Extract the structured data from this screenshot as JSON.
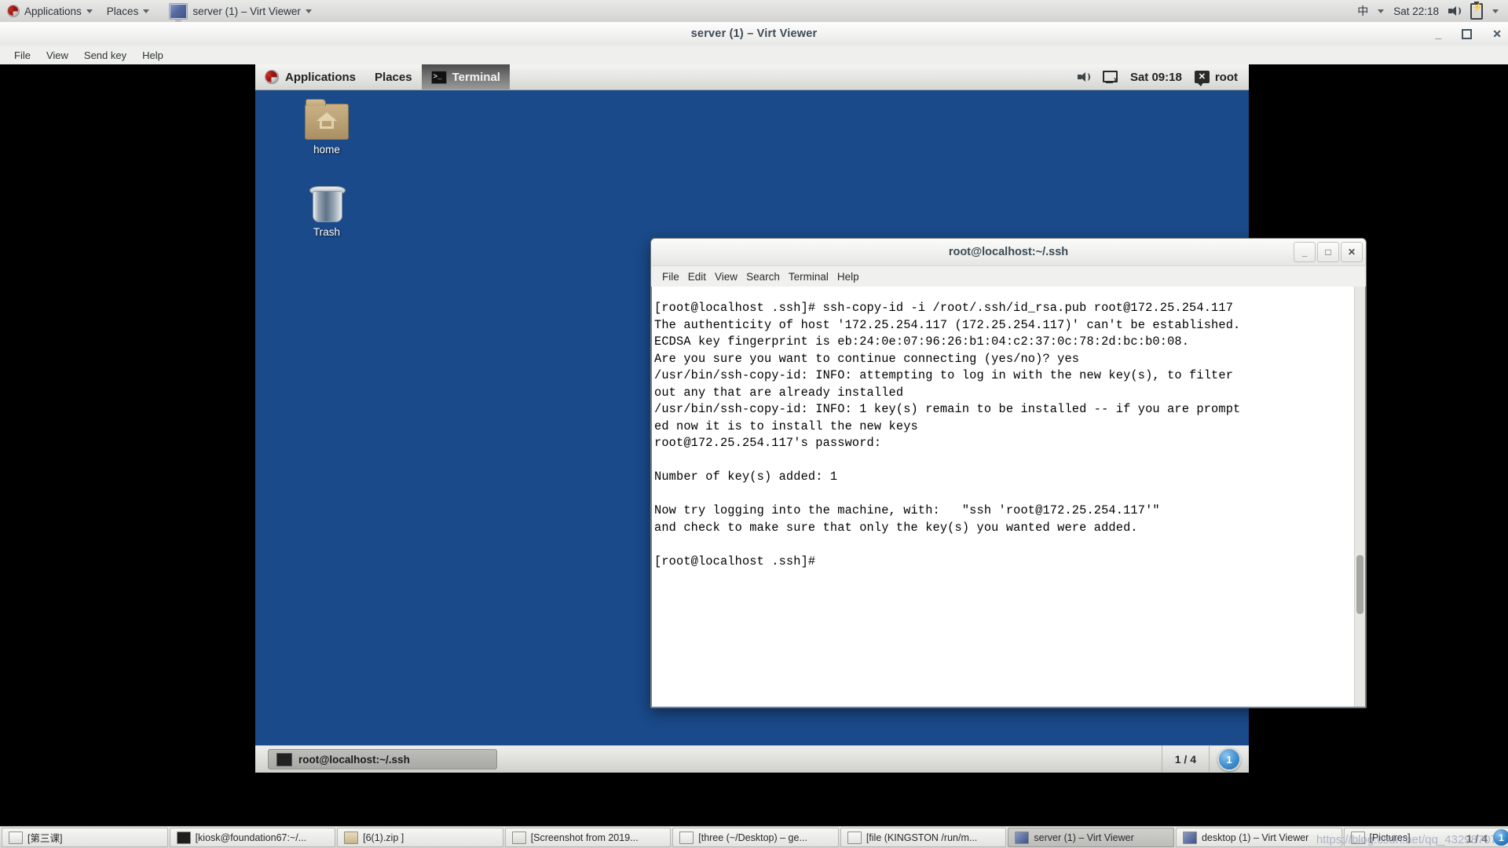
{
  "host_panel": {
    "applications": "Applications",
    "places": "Places",
    "window_task": "server (1) – Virt Viewer",
    "ime": "中",
    "clock": "Sat 22:18",
    "icons": {
      "fedora": "fedora-logo",
      "speaker": "volume-icon",
      "battery": "battery-icon"
    }
  },
  "virt_viewer": {
    "title": "server (1) – Virt Viewer",
    "menu": [
      "File",
      "View",
      "Send key",
      "Help"
    ],
    "window_buttons": {
      "minimize": "_",
      "maximize": "□",
      "close": "✕"
    }
  },
  "guest_panel": {
    "applications": "Applications",
    "places": "Places",
    "active_task": "Terminal",
    "clock": "Sat 09:18",
    "user": "root"
  },
  "desktop_icons": [
    {
      "label": "home",
      "icon": "home-folder-icon"
    },
    {
      "label": "Trash",
      "icon": "trash-icon"
    }
  ],
  "terminal": {
    "title": "root@localhost:~/.ssh",
    "menu": [
      "File",
      "Edit",
      "View",
      "Search",
      "Terminal",
      "Help"
    ],
    "window_buttons": {
      "minimize": "_",
      "maximize": "□",
      "close": "✕"
    },
    "content": "[root@localhost .ssh]# ssh-copy-id -i /root/.ssh/id_rsa.pub root@172.25.254.117\nThe authenticity of host '172.25.254.117 (172.25.254.117)' can't be established.\nECDSA key fingerprint is eb:24:0e:07:96:26:b1:04:c2:37:0c:78:2d:bc:b0:08.\nAre you sure you want to continue connecting (yes/no)? yes\n/usr/bin/ssh-copy-id: INFO: attempting to log in with the new key(s), to filter\nout any that are already installed\n/usr/bin/ssh-copy-id: INFO: 1 key(s) remain to be installed -- if you are prompt\ned now it is to install the new keys\nroot@172.25.254.117's password:\n\nNumber of key(s) added: 1\n\nNow try logging into the machine, with:   \"ssh 'root@172.25.254.117'\"\nand check to make sure that only the key(s) you wanted were added.\n\n[root@localhost .ssh]#"
  },
  "guest_taskbar": {
    "task_label": "root@localhost:~/.ssh",
    "workspace_count": "1 / 4",
    "workspace_badge": "1"
  },
  "host_taskbar": {
    "items": [
      {
        "label": "[第三课]",
        "icon": "doc",
        "active": false
      },
      {
        "label": "[kiosk@foundation67:~/...",
        "icon": "term",
        "active": false
      },
      {
        "label": "[6(1).zip ]",
        "icon": "zip",
        "active": false
      },
      {
        "label": "[Screenshot from 2019...",
        "icon": "mag",
        "active": false
      },
      {
        "label": "[three (~/Desktop) – ge...",
        "icon": "note",
        "active": false
      },
      {
        "label": "[file (KINGSTON /run/m...",
        "icon": "note",
        "active": false
      },
      {
        "label": "server (1) – Virt Viewer",
        "icon": "mon",
        "active": true
      },
      {
        "label": "desktop (1) – Virt Viewer",
        "icon": "mon",
        "active": false
      },
      {
        "label": "[Pictures]",
        "icon": "pic",
        "active": false
      }
    ],
    "watermark": "https://blog.csdn.net/qq_43298707",
    "workspace_count": "1 / 4",
    "workspace_badge": "1"
  }
}
